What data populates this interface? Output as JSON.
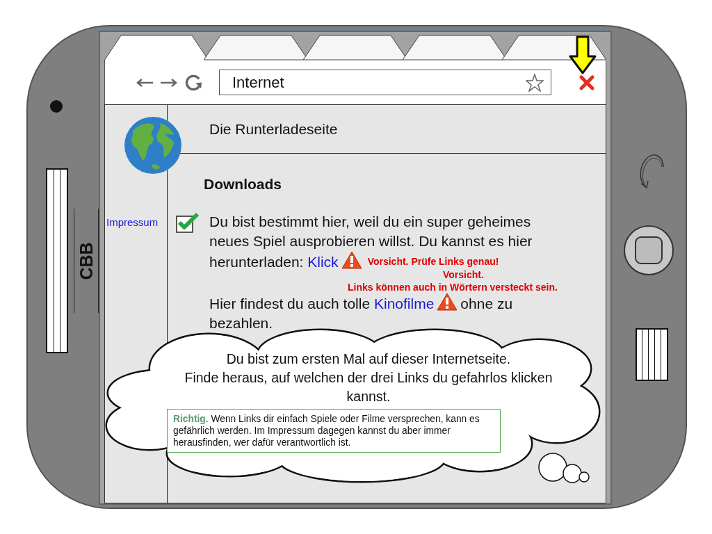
{
  "device": {
    "label": "CBB"
  },
  "browser": {
    "tabs": [
      {
        "selected": true
      },
      {
        "selected": false
      },
      {
        "selected": false
      },
      {
        "selected": false
      },
      {
        "selected": false
      }
    ],
    "address_bar": {
      "value": "Internet"
    }
  },
  "page": {
    "title": "Die Runterladeseite",
    "sidebar": {
      "link": "Impressum",
      "checked": true
    },
    "heading": "Downloads",
    "paragraphs": [
      {
        "segments": [
          {
            "kind": "text",
            "text": "Du bist bestimmt hier, weil du ein super geheimes neues Spiel ausprobieren willst. Du kannst es hier herunterladen: "
          },
          {
            "kind": "link",
            "text": "Klick"
          },
          {
            "kind": "warning",
            "note": "Vorsicht. Prüfe Links genau!"
          }
        ]
      },
      {
        "segments": [
          {
            "kind": "text",
            "text": "Hier findest du auch tolle "
          },
          {
            "kind": "link",
            "text": "Kinofilme"
          },
          {
            "kind": "warning"
          },
          {
            "kind": "text",
            "text": "ohne zu bezahlen."
          }
        ]
      }
    ],
    "warnings": [
      "Vorsicht.",
      "Links können auch in Wörtern versteckt sein."
    ]
  },
  "hint": {
    "sentences": [
      "Du bist zum ersten Mal auf dieser Internetseite.",
      "Finde heraus, auf welchen der drei Links du gefahrlos klicken kannst."
    ],
    "feedback": "**Richtig**. Wenn Links dir einfach Spiele oder Filme versprechen, kann es gefährlich werden. Im Impressum dagegen kannst du aber immer herausfinden, wer dafür verantwortlich ist."
  }
}
